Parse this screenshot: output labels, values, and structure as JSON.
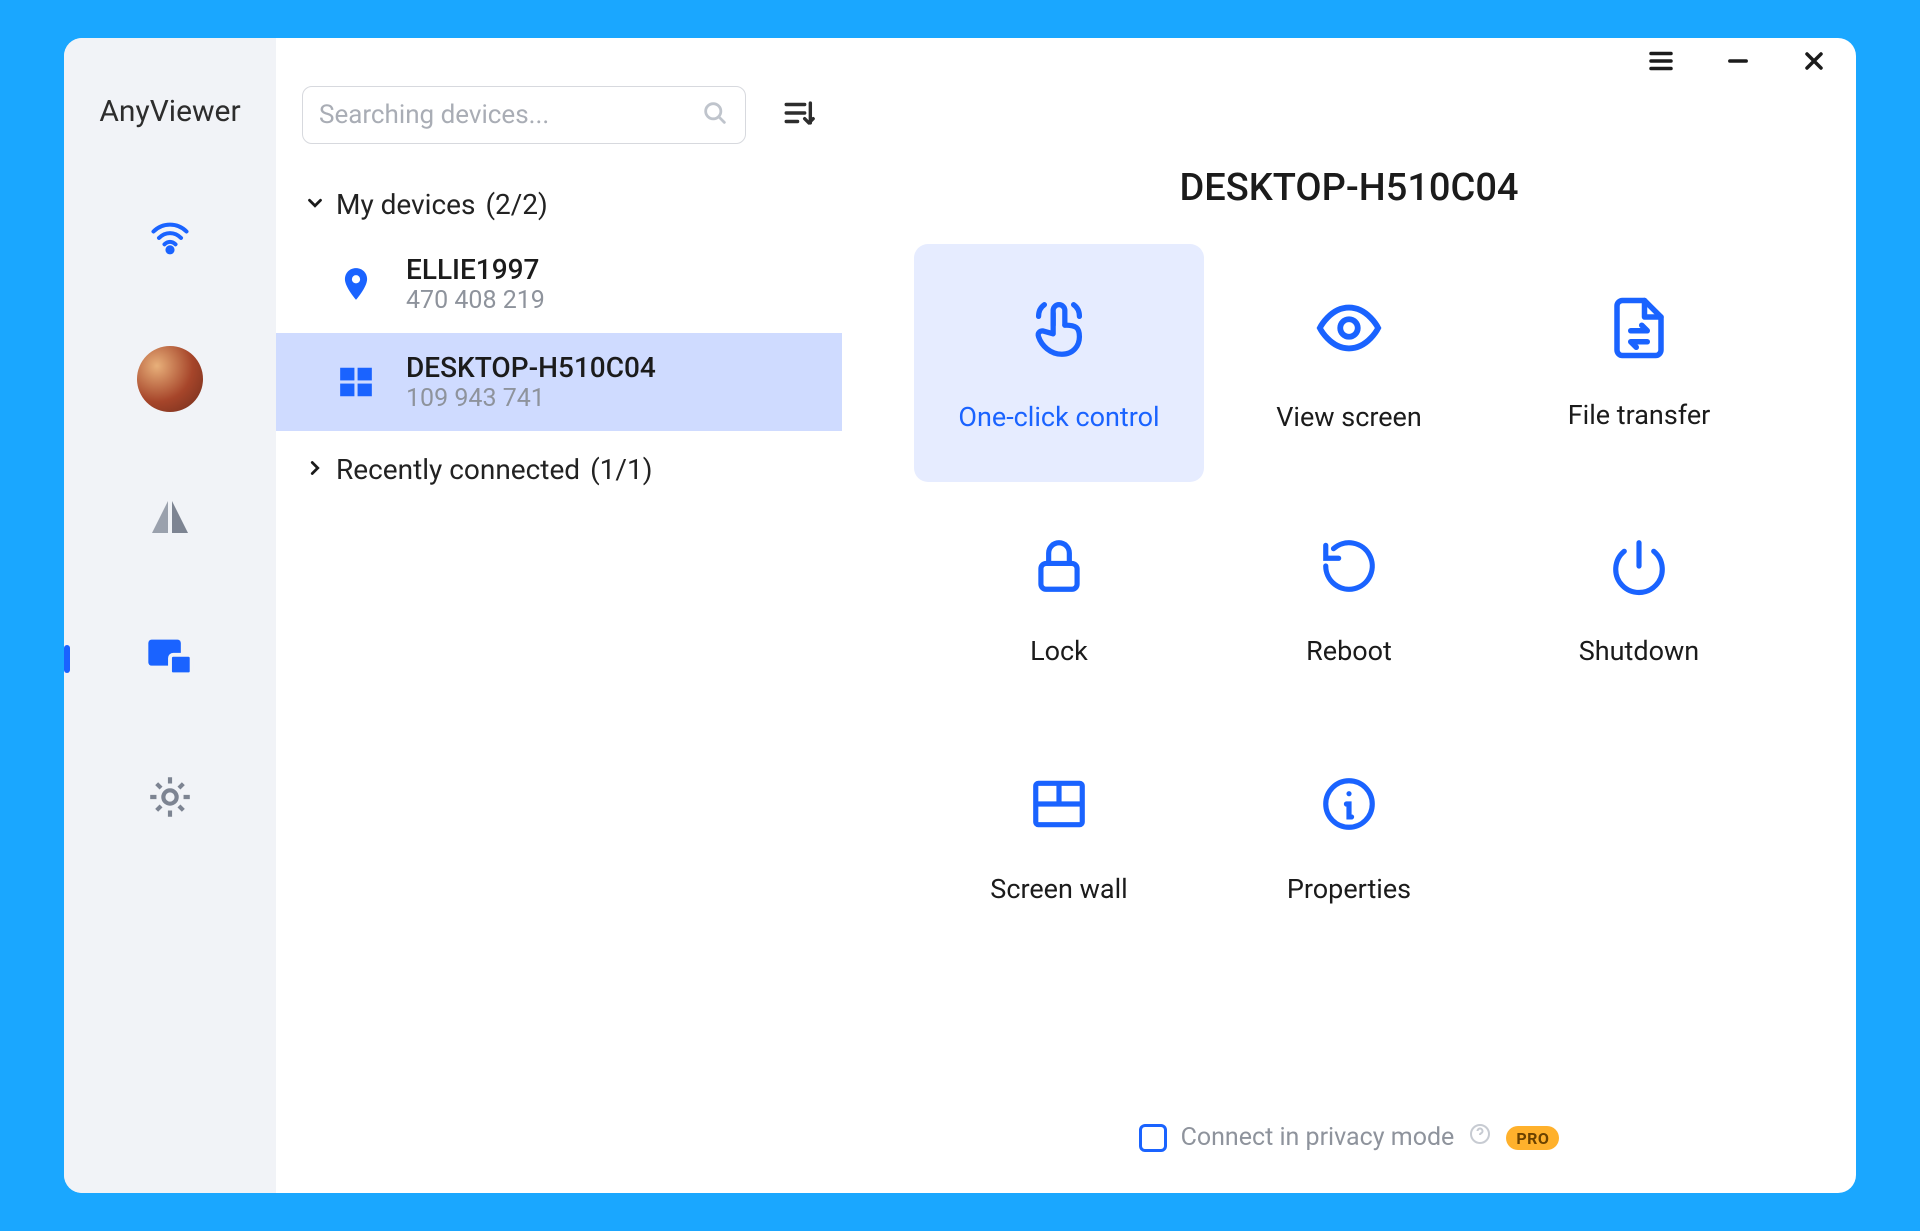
{
  "brand": "AnyViewer",
  "search": {
    "placeholder": "Searching devices..."
  },
  "tree": {
    "my_devices": {
      "label": "My devices",
      "count": "(2/2)"
    },
    "recent": {
      "label": "Recently connected",
      "count": "(1/1)"
    }
  },
  "devices": [
    {
      "name": "ELLIE1997",
      "id": "470 408 219",
      "icon": "location"
    },
    {
      "name": "DESKTOP-H510C04",
      "id": "109 943 741",
      "icon": "windows"
    }
  ],
  "detail": {
    "title": "DESKTOP-H510C04",
    "actions": {
      "one_click": "One-click control",
      "view_screen": "View screen",
      "file_xfer": "File transfer",
      "lock": "Lock",
      "reboot": "Reboot",
      "shutdown": "Shutdown",
      "screen_wall": "Screen wall",
      "properties": "Properties"
    },
    "privacy_label": "Connect in privacy mode",
    "pro_badge": "PRO"
  }
}
